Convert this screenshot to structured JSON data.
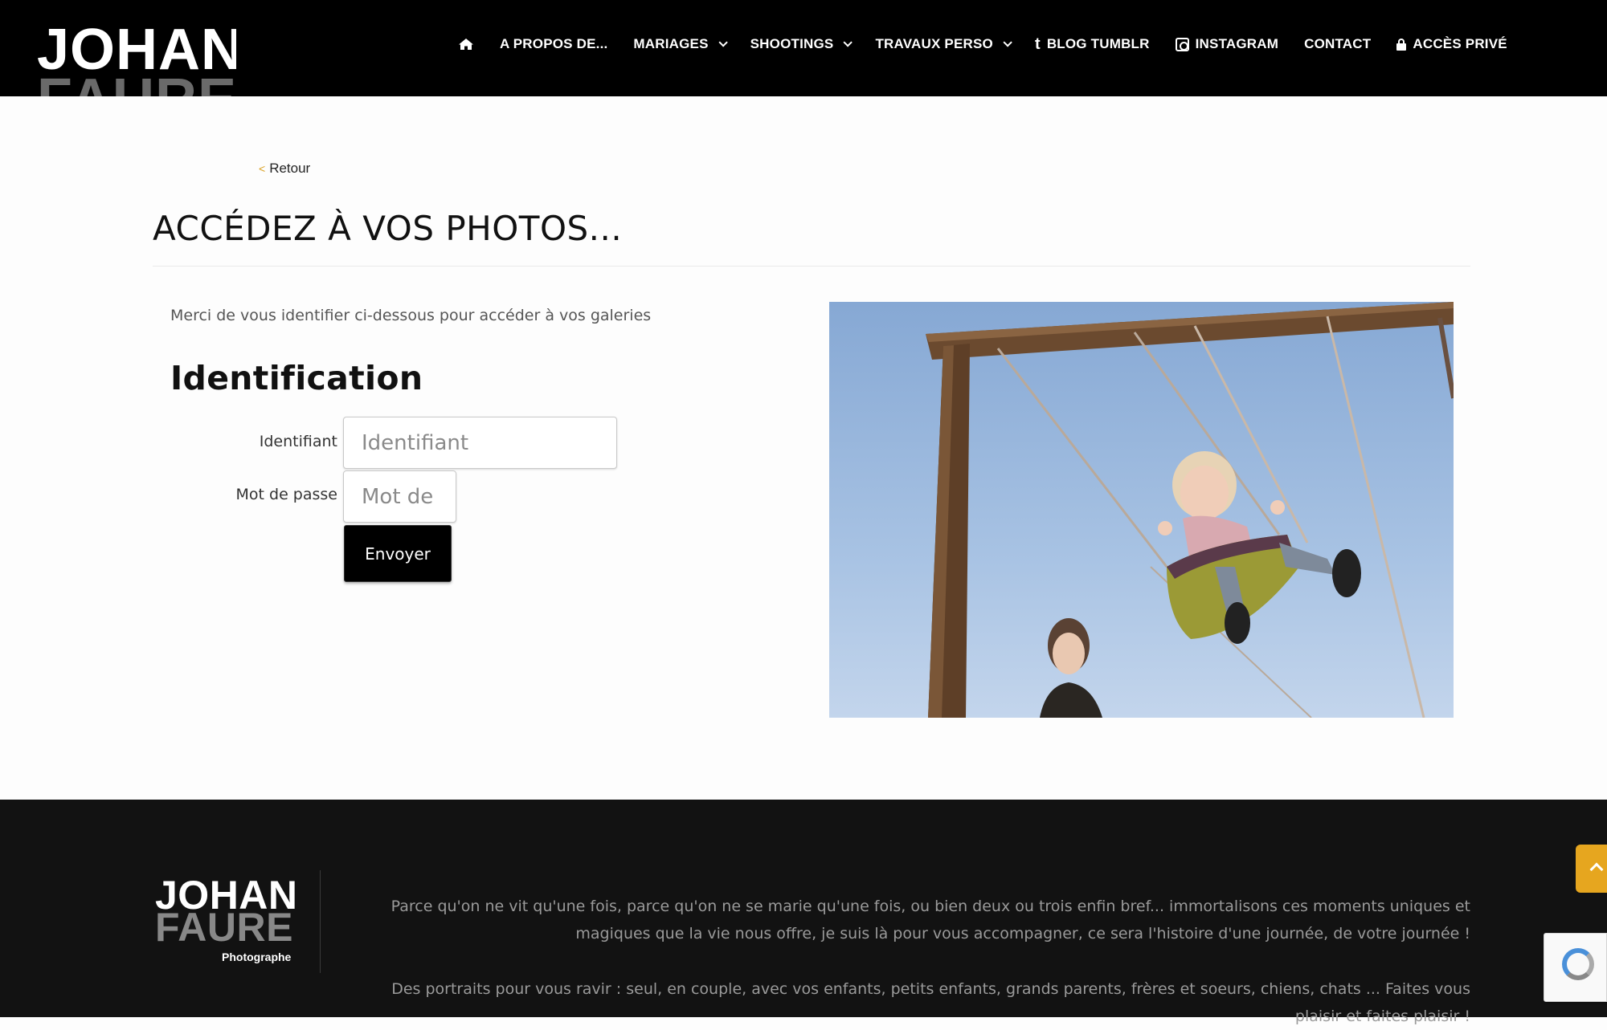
{
  "header": {
    "logo_line1": "JOHAN",
    "logo_line2": "FAURE",
    "nav": [
      {
        "label": "",
        "icon": "home-icon"
      },
      {
        "label": "A PROPOS DE..."
      },
      {
        "label": "MARIAGES",
        "dropdown": true
      },
      {
        "label": "SHOOTINGS",
        "dropdown": true
      },
      {
        "label": "TRAVAUX PERSO",
        "dropdown": true
      },
      {
        "label": "BLOG TUMBLR",
        "icon": "tumblr-icon"
      },
      {
        "label": "INSTAGRAM",
        "icon": "instagram-icon"
      },
      {
        "label": "CONTACT"
      },
      {
        "label": "ACCÈS PRIVÉ",
        "icon": "lock-icon"
      }
    ]
  },
  "main": {
    "back_label": "Retour",
    "back_glyph": "<",
    "title": "ACCÉDEZ À VOS PHOTOS...",
    "intro": "Merci de vous identifier ci-dessous pour accéder à vos galeries",
    "form": {
      "heading": "Identification",
      "username_label": "Identifiant",
      "username_placeholder": "Identifiant",
      "password_label": "Mot de passe",
      "password_placeholder": "Mot de",
      "submit_label": "Envoyer"
    }
  },
  "footer": {
    "logo_line1": "JOHAN",
    "logo_line2": "FAURE",
    "logo_line3": "Photographe",
    "text1": "Parce qu'on ne vit qu'une fois, parce qu'on ne se marie qu'une fois, ou bien deux ou trois enfin bref... immortalisons ces moments uniques et magiques que la vie nous offre, je suis là pour vous accompagner, ce sera l'histoire d'une journée, de votre journée !",
    "text2": "Des portraits pour vous ravir : seul, en couple, avec vos enfants, petits enfants, grands parents, frères et soeurs, chiens, chats ... Faites vous plaisir et faites plaisir !"
  },
  "colors": {
    "header_bg": "#000000",
    "footer_bg": "#121212",
    "accent": "#e6a61f"
  }
}
